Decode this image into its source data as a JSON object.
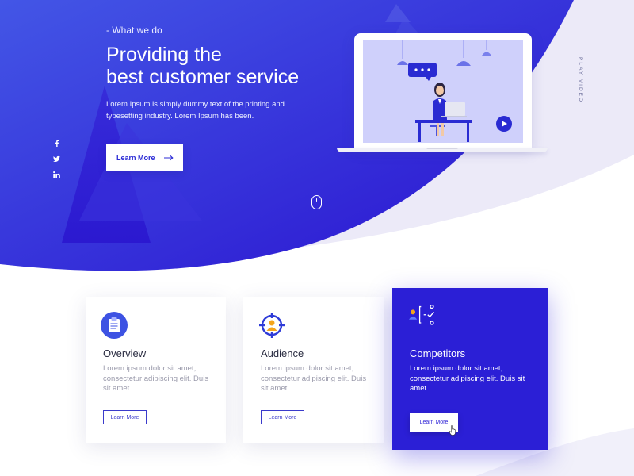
{
  "hero": {
    "eyebrow": "- What we do",
    "title_line1": "Providing the",
    "title_line2": "best customer service",
    "description": "Lorem Ipsum is simply dummy text of the printing and typesetting industry. Lorem Ipsum has been.",
    "button_label": "Learn More",
    "button_icon": "arrow-right-icon"
  },
  "social": [
    {
      "name": "facebook",
      "icon": "facebook-icon"
    },
    {
      "name": "twitter",
      "icon": "twitter-icon"
    },
    {
      "name": "linkedin",
      "icon": "linkedin-icon"
    }
  ],
  "video": {
    "play_label": "PLAY VIDEO",
    "play_icon": "play-icon"
  },
  "scroll_indicator_icon": "mouse-scroll-icon",
  "cards": [
    {
      "title": "Overview",
      "description": "Lorem ipsum dolor sit amet, consectetur adipiscing elit. Duis sit amet..",
      "button_label": "Learn More",
      "icon": "clipboard-icon",
      "active": false
    },
    {
      "title": "Audience",
      "description": "Lorem ipsum dolor sit amet, consectetur adipiscing elit. Duis sit amet..",
      "button_label": "Learn More",
      "icon": "target-user-icon",
      "active": false
    },
    {
      "title": "Competitors",
      "description": "Lorem ipsum dolor sit amet, consectetur adipiscing elit. Duis sit amet..",
      "button_label": "Learn More",
      "icon": "competitor-hierarchy-icon",
      "active": true
    }
  ],
  "colors": {
    "primary": "#2b1fd6",
    "hero_gradient_start": "#3d4ae4",
    "hero_gradient_end": "#2a14d0",
    "text_dark": "#2b2d42",
    "text_muted": "#9a9aab",
    "lavender": "#eceaf8"
  }
}
